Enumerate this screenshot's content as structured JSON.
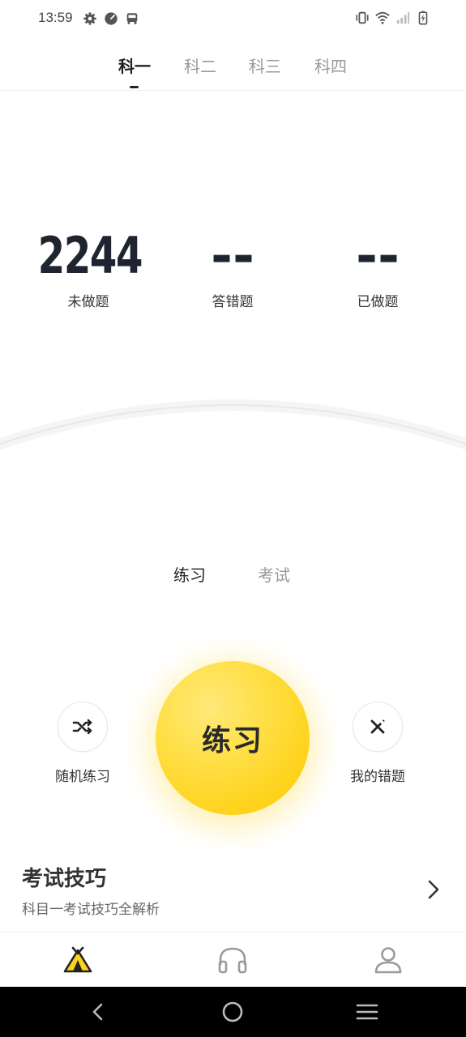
{
  "status_bar": {
    "time": "13:59",
    "left_icons": [
      "gear-icon",
      "speed-icon",
      "bus-icon"
    ],
    "right_icons": [
      "vibrate-icon",
      "wifi-icon",
      "signal-icon",
      "battery-charging-icon"
    ]
  },
  "tabs": [
    {
      "label": "科一",
      "active": true
    },
    {
      "label": "科二",
      "active": false
    },
    {
      "label": "科三",
      "active": false
    },
    {
      "label": "科四",
      "active": false
    }
  ],
  "stats": [
    {
      "value": "2244",
      "label": "未做题"
    },
    {
      "value": "--",
      "label": "答错题"
    },
    {
      "value": "--",
      "label": "已做题"
    }
  ],
  "modes": [
    {
      "label": "练习",
      "active": true
    },
    {
      "label": "考试",
      "active": false
    }
  ],
  "actions": {
    "random_label": "随机练习",
    "main_label": "练习",
    "wrong_label": "我的错题"
  },
  "tips": {
    "title": "考试技巧",
    "subtitle": "科目一考试技巧全解析"
  },
  "bottom_nav": [
    "tent-icon",
    "headphones-icon",
    "user-icon"
  ],
  "colors": {
    "accent": "#FFD21A",
    "text_dark": "#1E2430",
    "muted": "#9A9A9A"
  }
}
